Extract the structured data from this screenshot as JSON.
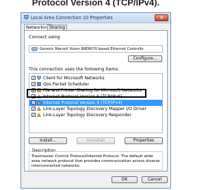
{
  "caption": "Protocol Version 4 (TCP/IPv4).",
  "window": {
    "title": "Local Area Connection 10 Properties",
    "close": "✕"
  },
  "tabs": [
    {
      "label": "Networking"
    },
    {
      "label": "Sharing"
    }
  ],
  "connect_using": {
    "label": "Connect using",
    "adapter": "Generic Marvell Yukon 88E8070 based Ethernet Controlle",
    "configure": "Configure..."
  },
  "items_label": "This connection uses the following items:",
  "items": [
    {
      "label": "Client for Microsoft Networks",
      "checked": true,
      "icon": "network-client-icon"
    },
    {
      "label": "Qos Packet Scheduler",
      "checked": true,
      "icon": "qos-icon"
    },
    {
      "label": "File and Printer Sharing for Microsoft Networks",
      "checked": true,
      "icon": "file-sharing-icon"
    },
    {
      "label": "Internet Protocol Version 6 (TCP/IPv6)",
      "checked": true,
      "icon": "protocol-icon"
    },
    {
      "label": "Internet Protocol Version 4 (TCP/IPv4)",
      "checked": true,
      "icon": "protocol-icon"
    },
    {
      "label": "Link-Layer Topology Discovery Mapper I/O Driver",
      "checked": true,
      "icon": "protocol-icon"
    },
    {
      "label": "Link-Layer Topology Discovery Responder",
      "checked": true,
      "icon": "protocol-icon"
    }
  ],
  "buttons": {
    "install": "Install...",
    "uninstall": "Uninstall",
    "properties": "Properties",
    "ok": "OK",
    "cancel": "Cancel"
  },
  "description": {
    "title": "Description",
    "text": "Trasmission Control Protocol/Internet Protocol. The default wide area network protocol that provides communication across diverse interconnected networks."
  },
  "colors": {
    "accent": "#6d8fb3",
    "highlight_border": "#000000",
    "selection": "#3399ff"
  }
}
